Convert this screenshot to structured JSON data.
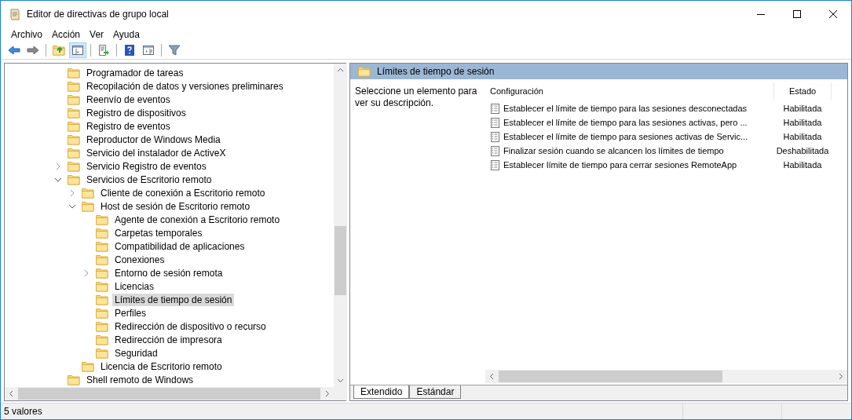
{
  "window": {
    "title": "Editor de directivas de grupo local"
  },
  "menu": [
    "Archivo",
    "Acción",
    "Ver",
    "Ayuda"
  ],
  "tree": [
    {
      "label": "Programador de tareas",
      "selected": false
    },
    {
      "label": "Recopilación de datos y versiones preliminares",
      "selected": false
    },
    {
      "label": "Reenvío de eventos",
      "selected": false
    },
    {
      "label": "Registro de dispositivos",
      "selected": false
    },
    {
      "label": "Registro de eventos",
      "selected": false
    },
    {
      "label": "Reproductor de Windows Media",
      "selected": false
    },
    {
      "label": "Servicio del instalador de ActiveX",
      "selected": false
    },
    {
      "label": "Servicio Registro de eventos",
      "selected": false,
      "expanded": false
    },
    {
      "label": "Servicios de Escritorio remoto",
      "selected": false,
      "expanded": true,
      "children": [
        {
          "label": "Cliente de conexión a Escritorio remoto",
          "selected": false,
          "expanded": false
        },
        {
          "label": "Host de sesión de Escritorio remoto",
          "selected": false,
          "expanded": true,
          "children": [
            {
              "label": "Agente de conexión a Escritorio remoto",
              "selected": false
            },
            {
              "label": "Carpetas temporales",
              "selected": false
            },
            {
              "label": "Compatibilidad de aplicaciones",
              "selected": false
            },
            {
              "label": "Conexiones",
              "selected": false
            },
            {
              "label": "Entorno de sesión remota",
              "selected": false,
              "expanded": false
            },
            {
              "label": "Licencias",
              "selected": false
            },
            {
              "label": "Límites de tiempo de sesión",
              "selected": true
            },
            {
              "label": "Perfiles",
              "selected": false
            },
            {
              "label": "Redirección de dispositivo o recurso",
              "selected": false
            },
            {
              "label": "Redirección de impresora",
              "selected": false
            },
            {
              "label": "Seguridad",
              "selected": false
            }
          ]
        },
        {
          "label": "Licencia de Escritorio remoto",
          "selected": false
        }
      ]
    },
    {
      "label": "Shell remoto de Windows",
      "selected": false
    }
  ],
  "details": {
    "title": "Límites de tiempo de sesión",
    "description": "Seleccione un elemento para ver su descripción.",
    "columns": [
      "Configuración",
      "Estado"
    ],
    "rows": [
      {
        "setting": "Establecer el límite de tiempo para las sesiones desconectadas",
        "state": "Habilitada"
      },
      {
        "setting": "Establecer el límite de tiempo para las sesiones activas, pero ...",
        "state": "Habilitada"
      },
      {
        "setting": "Establecer el límite de tiempo para sesiones activas de Servic...",
        "state": "Habilitada"
      },
      {
        "setting": "Finalizar sesión cuando se alcancen los límites de tiempo",
        "state": "Deshabilitada"
      },
      {
        "setting": "Establecer límite de tiempo para cerrar sesiones RemoteApp",
        "state": "Habilitada"
      }
    ],
    "tabs": [
      {
        "label": "Extendido",
        "selected": true
      },
      {
        "label": "Estándar",
        "selected": false
      }
    ]
  },
  "status_bar": "5 valores"
}
